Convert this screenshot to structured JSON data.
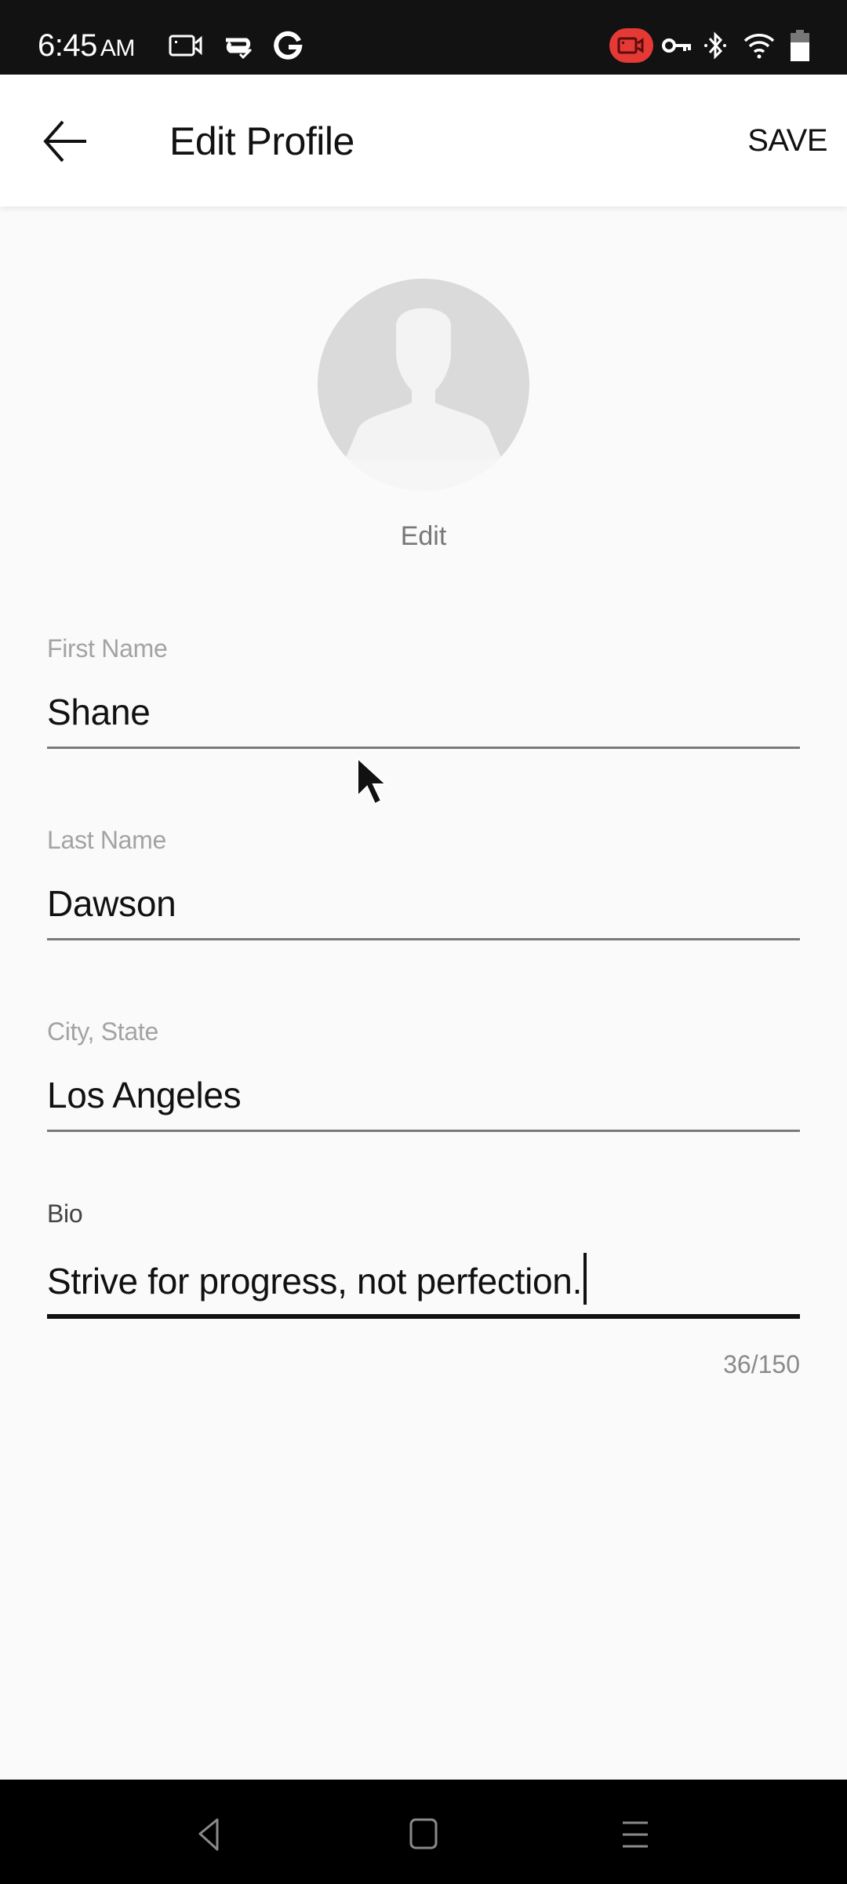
{
  "status_bar": {
    "time": "6:45",
    "ampm": "AM",
    "left_icons": [
      "screen-record-icon",
      "sync-check-icon",
      "google-icon"
    ],
    "right_icons": [
      "recording-active-icon",
      "vpn-key-icon",
      "bluetooth-icon",
      "wifi-icon",
      "battery-icon"
    ],
    "recording_color": "#e53935"
  },
  "app_bar": {
    "back_icon": "arrow-left-icon",
    "title": "Edit Profile",
    "save_label": "SAVE"
  },
  "profile": {
    "avatar_icon": "default-avatar-icon",
    "edit_label": "Edit"
  },
  "form": {
    "first_name": {
      "label": "First Name",
      "value": "Shane"
    },
    "last_name": {
      "label": "Last Name",
      "value": "Dawson"
    },
    "city_state": {
      "label": "City, State",
      "value": "Los Angeles"
    },
    "bio": {
      "label": "Bio",
      "value": "Strive for progress, not perfection.",
      "counter": "36/150",
      "focused": true
    }
  },
  "nav_bar": {
    "back": "nav-back-icon",
    "home": "nav-home-icon",
    "recents": "nav-recents-icon"
  }
}
